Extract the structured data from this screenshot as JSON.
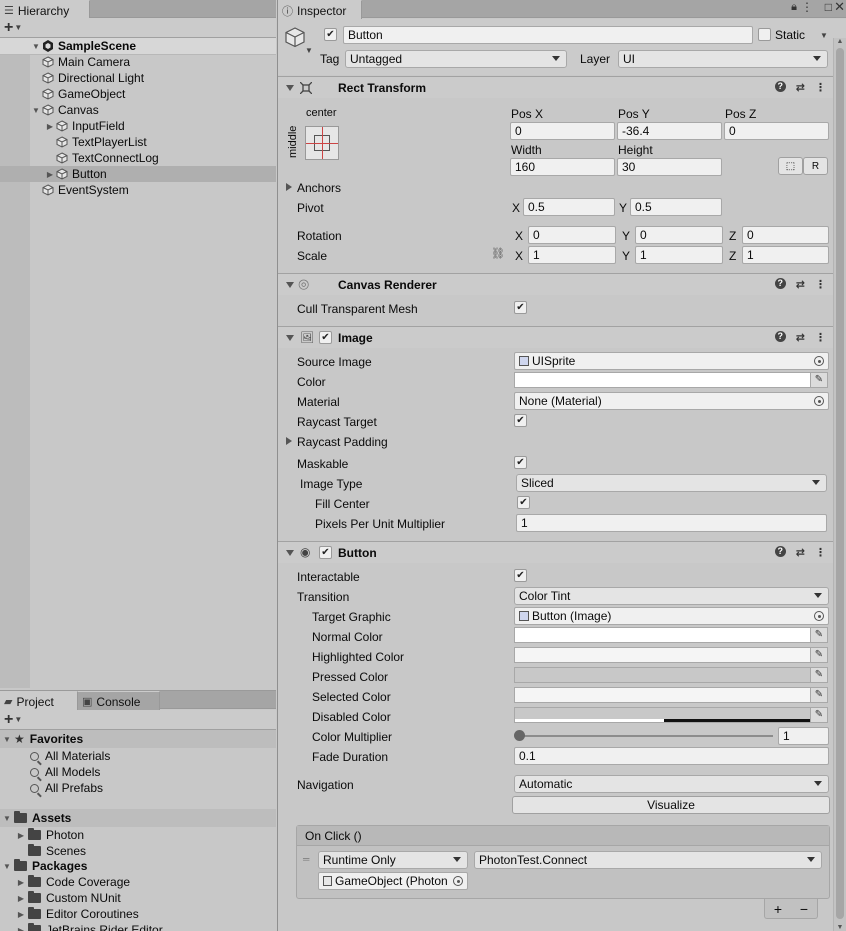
{
  "hierarchy": {
    "tab_label": "Hierarchy",
    "scene_name": "SampleScene",
    "items": [
      {
        "label": "Main Camera",
        "depth": 1,
        "arrow": ""
      },
      {
        "label": "Directional Light",
        "depth": 1,
        "arrow": ""
      },
      {
        "label": "GameObject",
        "depth": 1,
        "arrow": ""
      },
      {
        "label": "Canvas",
        "depth": 1,
        "arrow": "expanded"
      },
      {
        "label": "InputField",
        "depth": 2,
        "arrow": "collapsed"
      },
      {
        "label": "TextPlayerList",
        "depth": 2,
        "arrow": ""
      },
      {
        "label": "TextConnectLog",
        "depth": 2,
        "arrow": ""
      },
      {
        "label": "Button",
        "depth": 2,
        "arrow": "collapsed",
        "selected": true
      },
      {
        "label": "EventSystem",
        "depth": 1,
        "arrow": ""
      }
    ]
  },
  "project": {
    "tab_project": "Project",
    "tab_console": "Console",
    "favorites_label": "Favorites",
    "favorites": [
      "All Materials",
      "All Models",
      "All Prefabs"
    ],
    "assets_label": "Assets",
    "assets": [
      {
        "label": "Photon",
        "arrow": "collapsed"
      },
      {
        "label": "Scenes",
        "arrow": ""
      }
    ],
    "packages_label": "Packages",
    "packages": [
      "Code Coverage",
      "Custom NUnit",
      "Editor Coroutines",
      "JetBrains Rider Editor"
    ]
  },
  "inspector": {
    "tab_label": "Inspector",
    "object_name": "Button",
    "static_label": "Static",
    "tag_label": "Tag",
    "tag_value": "Untagged",
    "layer_label": "Layer",
    "layer_value": "UI",
    "rect_transform": {
      "title": "Rect Transform",
      "anchor_h": "center",
      "anchor_v": "middle",
      "posx_label": "Pos X",
      "posx": "0",
      "posy_label": "Pos Y",
      "posy": "-36.4",
      "posz_label": "Pos Z",
      "posz": "0",
      "width_label": "Width",
      "width": "160",
      "height_label": "Height",
      "height": "30",
      "r_button": "R",
      "anchors_label": "Anchors",
      "pivot_label": "Pivot",
      "pivot_x": "0.5",
      "pivot_y": "0.5",
      "rotation_label": "Rotation",
      "rot_x": "0",
      "rot_y": "0",
      "rot_z": "0",
      "scale_label": "Scale",
      "scale_x": "1",
      "scale_y": "1",
      "scale_z": "1",
      "x": "X",
      "y": "Y",
      "z": "Z"
    },
    "canvas_renderer": {
      "title": "Canvas Renderer",
      "cull_label": "Cull Transparent Mesh"
    },
    "image": {
      "title": "Image",
      "source_image_label": "Source Image",
      "source_image": "UISprite",
      "color_label": "Color",
      "material_label": "Material",
      "material": "None (Material)",
      "raycast_target_label": "Raycast Target",
      "raycast_padding_label": "Raycast Padding",
      "maskable_label": "Maskable",
      "image_type_label": "Image Type",
      "image_type": "Sliced",
      "fill_center_label": "Fill Center",
      "ppu_label": "Pixels Per Unit Multiplier",
      "ppu": "1"
    },
    "button": {
      "title": "Button",
      "interactable_label": "Interactable",
      "transition_label": "Transition",
      "transition": "Color Tint",
      "target_graphic_label": "Target Graphic",
      "target_graphic": "Button (Image)",
      "normal_color_label": "Normal Color",
      "highlighted_color_label": "Highlighted Color",
      "pressed_color_label": "Pressed Color",
      "selected_color_label": "Selected Color",
      "disabled_color_label": "Disabled Color",
      "color_multiplier_label": "Color Multiplier",
      "color_multiplier": "1",
      "fade_duration_label": "Fade Duration",
      "fade_duration": "0.1",
      "navigation_label": "Navigation",
      "navigation": "Automatic",
      "visualize_label": "Visualize",
      "onclick_label": "On Click ()",
      "onclick_mode": "Runtime Only",
      "onclick_function": "PhotonTest.Connect",
      "onclick_target": "GameObject (Photon",
      "add": "+",
      "remove": "−"
    }
  }
}
